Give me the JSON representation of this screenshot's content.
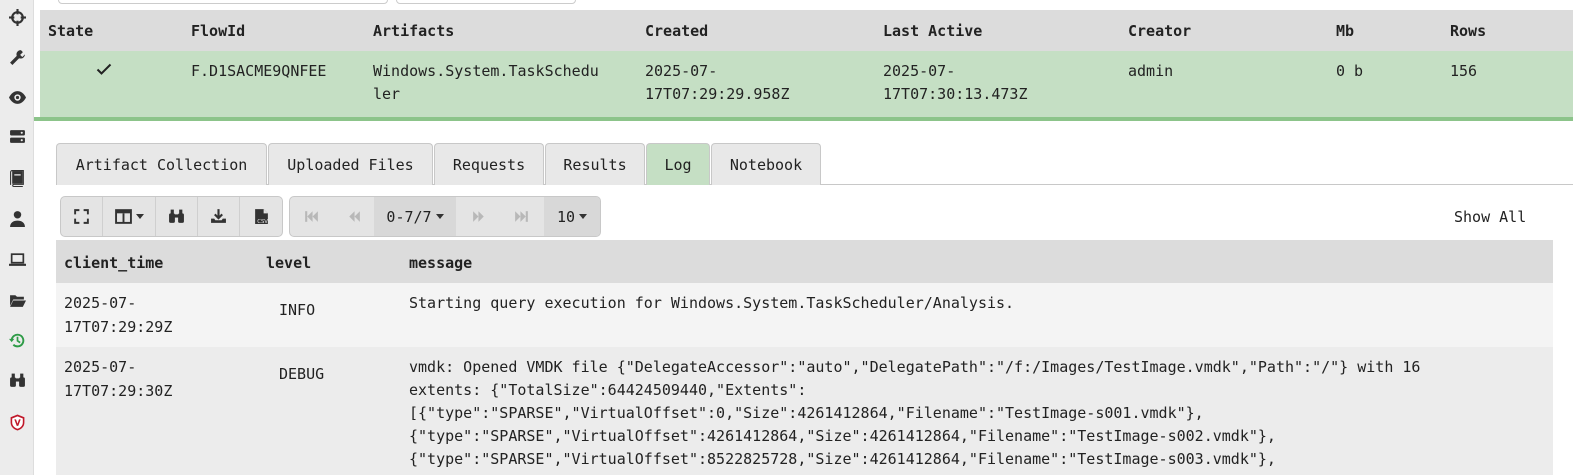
{
  "sidebar": {
    "items": [
      {
        "icon": "crosshair-icon"
      },
      {
        "icon": "wrench-icon"
      },
      {
        "icon": "eye-icon"
      },
      {
        "icon": "server-icon"
      },
      {
        "icon": "book-icon"
      },
      {
        "icon": "user-icon"
      },
      {
        "icon": "laptop-icon"
      },
      {
        "icon": "folder-open-icon"
      },
      {
        "icon": "history-icon",
        "active": true
      },
      {
        "icon": "binoculars-icon"
      },
      {
        "icon": "velociraptor-shield-icon"
      }
    ]
  },
  "flows_table": {
    "headers": {
      "state": "State",
      "flow_id": "FlowId",
      "artifacts": "Artifacts",
      "created": "Created",
      "last_active": "Last Active",
      "creator": "Creator",
      "mb": "Mb",
      "rows": "Rows"
    },
    "row": {
      "state_icon": "checkmark-icon",
      "flow_id": "F.D1SACME9QNFEE",
      "artifacts_line1": "Windows.System.TaskSchedu",
      "artifacts_line2": "ler",
      "created_line1": "2025-07-",
      "created_line2": "17T07:29:29.958Z",
      "last_active_line1": "2025-07-",
      "last_active_line2": "17T07:30:13.473Z",
      "creator": "admin",
      "mb": "0 b",
      "rows": "156"
    }
  },
  "tabs": [
    {
      "label": "Artifact Collection"
    },
    {
      "label": "Uploaded Files"
    },
    {
      "label": "Requests"
    },
    {
      "label": "Results"
    },
    {
      "label": "Log",
      "active": true
    },
    {
      "label": "Notebook"
    }
  ],
  "toolbar": {
    "page_range": "0-7/7",
    "page_size": "10",
    "show_all": "Show All"
  },
  "log_table": {
    "headers": {
      "client_time": "client_time",
      "level": "level",
      "message": "message"
    },
    "rows": [
      {
        "time_line1": "2025-07-",
        "time_line2": "17T07:29:29Z",
        "level": "INFO",
        "message_lines": [
          "Starting query execution for Windows.System.TaskScheduler/Analysis."
        ]
      },
      {
        "time_line1": "2025-07-",
        "time_line2": "17T07:29:30Z",
        "level": "DEBUG",
        "message_lines": [
          "vmdk: Opened VMDK file {\"DelegateAccessor\":\"auto\",\"DelegatePath\":\"/f:/Images/TestImage.vmdk\",\"Path\":\"/\"} with 16",
          "extents: {\"TotalSize\":64424509440,\"Extents\":",
          "[{\"type\":\"SPARSE\",\"VirtualOffset\":0,\"Size\":4261412864,\"Filename\":\"TestImage-s001.vmdk\"},",
          "{\"type\":\"SPARSE\",\"VirtualOffset\":4261412864,\"Size\":4261412864,\"Filename\":\"TestImage-s002.vmdk\"},",
          "{\"type\":\"SPARSE\",\"VirtualOffset\":8522825728,\"Size\":4261412864,\"Filename\":\"TestImage-s003.vmdk\"},"
        ]
      }
    ]
  },
  "colors": {
    "accent_green": "#c5dfc4",
    "rule_green": "#8cc48a",
    "header_gray": "#dcdcdc",
    "history_icon": "#2e9b47",
    "shield_icon": "#c0182a"
  }
}
